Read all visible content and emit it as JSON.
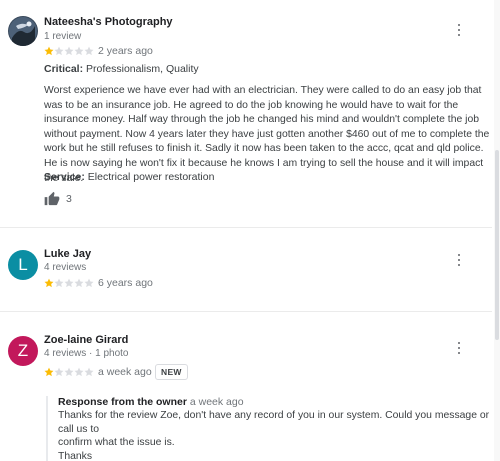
{
  "reviews": [
    {
      "name": "Nateesha's Photography",
      "meta": "1 review",
      "rating": 1,
      "time": "2 years ago",
      "critical_label": "Critical:",
      "critical_value": "Professionalism, Quality",
      "text": "Worst experience we have ever had with an electrician. They were called to do an easy job that was to be an insurance job. He agreed to do the job knowing he would have to wait for the insurance money. Half way through the job he changed his mind and wouldn't complete the job without payment. Now 4 years later they have just gotten another $460 out of me to complete the work but he still refuses to finish it. Sadly it now has been taken to the accc, qcat and qld police. He is now saying he won't fix it because he knows I am trying to sell the house and it will impact the sale.",
      "service_label": "Service:",
      "service_value": "Electrical power restoration",
      "likes": "3"
    },
    {
      "name": "Luke Jay",
      "meta": "4 reviews",
      "avatar_letter": "L",
      "avatar_color": "#0b8ea3",
      "rating": 1,
      "time": "6 years ago"
    },
    {
      "name": "Zoe-laine Girard",
      "meta": "4 reviews · 1 photo",
      "avatar_letter": "Z",
      "avatar_color": "#c2185b",
      "rating": 1,
      "time": "a week ago",
      "badge": "NEW",
      "owner_response": {
        "title": "Response from the owner",
        "time": "a week ago",
        "text_lines": [
          "Thanks for the review Zoe, don't have any record of you in our system. Could you message or call us to",
          "confirm what the issue is.",
          "Thanks"
        ]
      }
    }
  ],
  "colors": {
    "star_filled": "#fbbc04",
    "star_empty": "#dadce0"
  }
}
